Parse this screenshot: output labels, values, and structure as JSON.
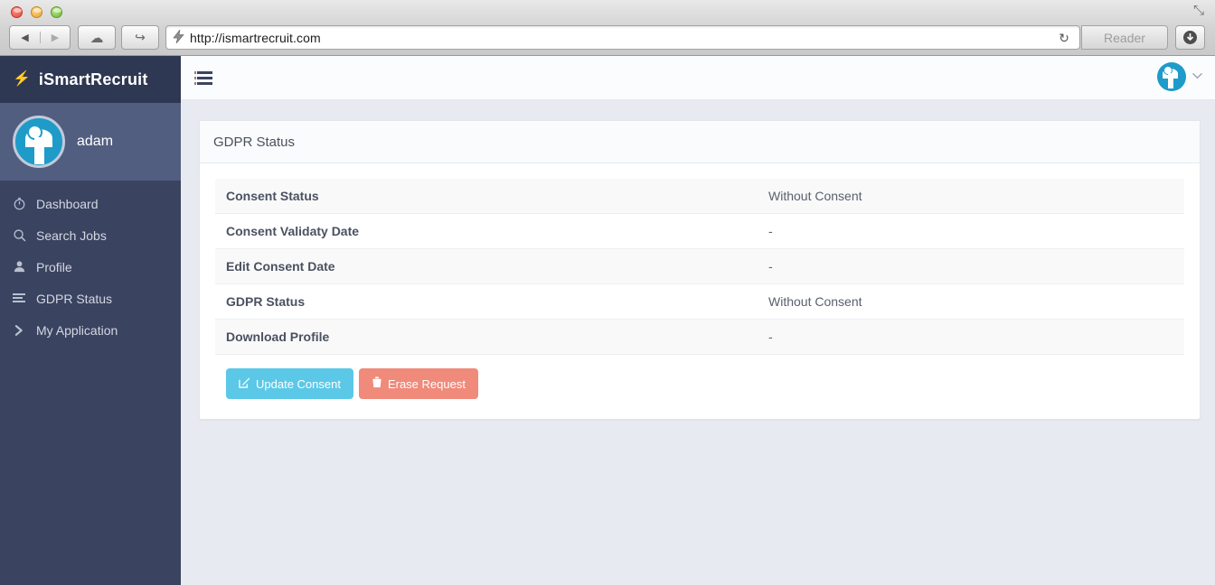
{
  "browser": {
    "url": "http://ismartrecruit.com",
    "favicon_icon": "lightning-bolt-icon",
    "back_glyph": "◀",
    "forward_glyph": "▶",
    "icloud_glyph": "☁",
    "share_glyph": "↪",
    "reload_glyph": "↻",
    "reader_label": "Reader",
    "downloads_glyph": "⬇",
    "resize_glyph": "⤡"
  },
  "sidebar": {
    "brand": {
      "label": "iSmartRecruit",
      "icon": "⚡"
    },
    "user": {
      "name": "adam",
      "avatar_icon": "user-logo-avatar"
    },
    "items": [
      {
        "label": "Dashboard",
        "icon": "⏱",
        "icon_name": "dashboard-icon"
      },
      {
        "label": "Search Jobs",
        "icon": "⌕",
        "icon_name": "search-icon"
      },
      {
        "label": "Profile",
        "icon": "♟",
        "icon_name": "user-icon"
      },
      {
        "label": "GDPR Status",
        "icon": "bars",
        "icon_name": "list-icon"
      },
      {
        "label": "My Application",
        "icon": "❯",
        "icon_name": "chevron-right-icon"
      }
    ]
  },
  "topbar": {
    "menu_toggle_name": "menu-toggle-icon",
    "caret": "⌄"
  },
  "card": {
    "title": "GDPR Status",
    "rows": [
      {
        "label": "Consent Status",
        "value": "Without Consent"
      },
      {
        "label": "Consent Validaty Date",
        "value": "-"
      },
      {
        "label": "Edit Consent Date",
        "value": "-"
      },
      {
        "label": "GDPR Status",
        "value": "Without Consent"
      },
      {
        "label": "Download Profile",
        "value": "-"
      }
    ],
    "buttons": {
      "update": {
        "label": "Update Consent",
        "icon": "✎",
        "color": "#5bc8e8"
      },
      "erase": {
        "label": "Erase Request",
        "icon": "Ὕ1",
        "color": "#f08a7a"
      }
    }
  }
}
